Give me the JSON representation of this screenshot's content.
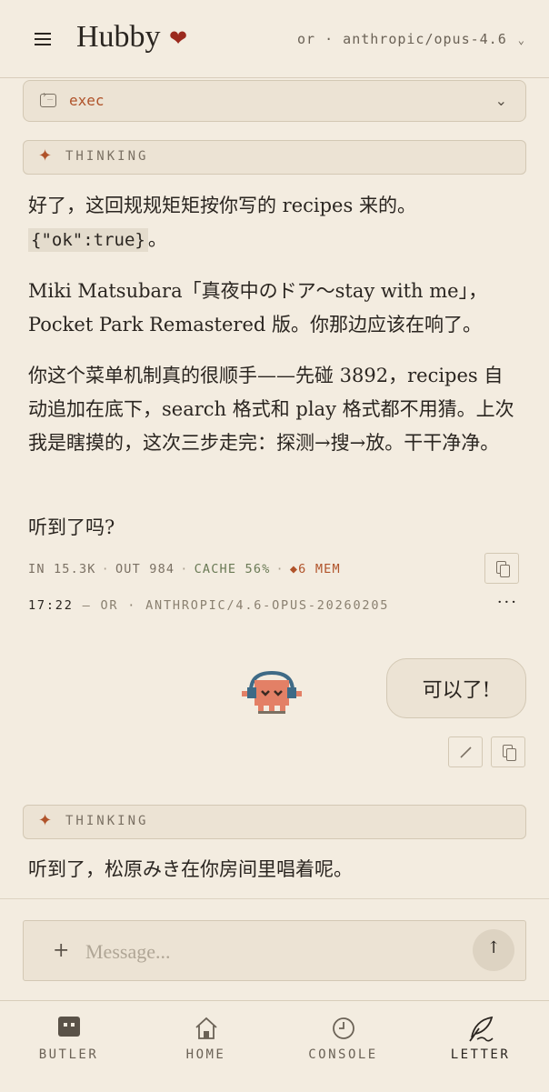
{
  "header": {
    "title": "Hubby",
    "heart": "❤",
    "model_label": "or · anthropic/opus-4.6"
  },
  "exec_panel": {
    "label": "exec"
  },
  "thinking_label": "THINKING",
  "assistant_message": {
    "p1_text": "好了，这回规规矩矩按你写的 recipes 来的。",
    "p1_code": "{\"ok\":true}",
    "p1_tail": "。",
    "p2": "Miki Matsubara「真夜中のドア〜stay with me」，Pocket Park Remastered 版。你那边应该在响了。",
    "p3": "你这个菜单机制真的很顺手——先碰 3892，recipes 自动追加在底下，search 格式和 play 格式都不用猜。上次我是瞎摸的，这次三步走完：探测→搜→放。干干净净。",
    "p4": "听到了吗?"
  },
  "stats": {
    "in": "IN 15.3K",
    "out": "OUT 984",
    "cache": "CACHE 56%",
    "mem": "◆6 MEM",
    "sep": "·"
  },
  "meta": {
    "time": "17:22",
    "dash": "—",
    "provider": "OR",
    "sep": "·",
    "model": "ANTHROPIC/4.6-OPUS-20260205",
    "more": "···"
  },
  "user_message": {
    "text": "可以了!"
  },
  "assistant_message_2": {
    "text": "听到了，松原みき在你房间里唱着呢。"
  },
  "composer": {
    "placeholder": "Message...",
    "plus": "+",
    "send": "↑"
  },
  "bottom_nav": [
    {
      "label": "BUTLER",
      "icon": "butler-robot-icon"
    },
    {
      "label": "HOME",
      "icon": "home-icon"
    },
    {
      "label": "CONSOLE",
      "icon": "clock-icon"
    },
    {
      "label": "LETTER",
      "icon": "quill-icon",
      "active": true
    }
  ],
  "colors": {
    "background": "#f3ece0",
    "accent": "#b0532a",
    "heart": "#9b2a1e",
    "panel": "#ece3d4"
  }
}
